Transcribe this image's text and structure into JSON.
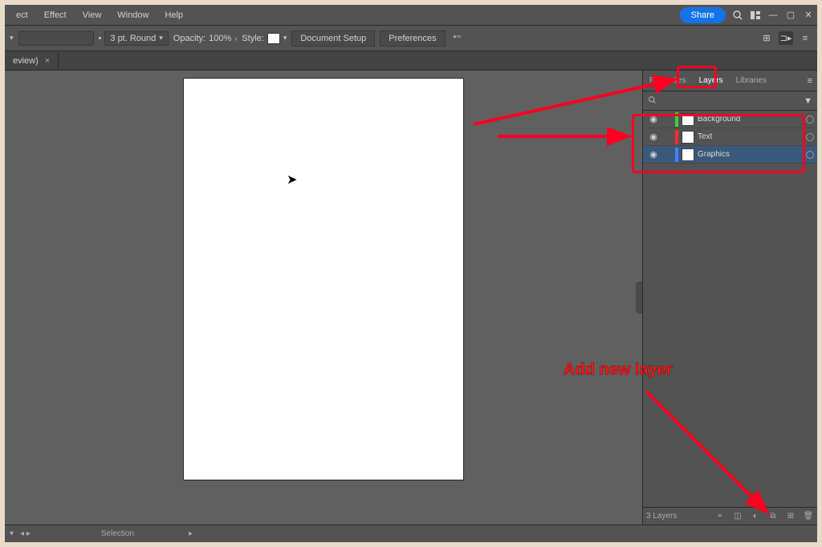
{
  "menu": {
    "items": [
      "ect",
      "Effect",
      "View",
      "Window",
      "Help"
    ],
    "share": "Share"
  },
  "ctrl": {
    "stroke_preset": "3 pt. Round",
    "opacity_label": "Opacity:",
    "opacity_value": "100%",
    "style_label": "Style:",
    "doc_setup": "Document Setup",
    "prefs": "Preferences"
  },
  "tab": {
    "name": "eview)",
    "close": "×"
  },
  "panels": {
    "tabs": [
      "Properties",
      "Layers",
      "Libraries"
    ],
    "active": 1,
    "layers": [
      {
        "name": "Background",
        "color": "#3fce3f"
      },
      {
        "name": "Text",
        "color": "#ff2a2a"
      },
      {
        "name": "Graphics",
        "color": "#4a7cff"
      }
    ],
    "layer_count": "3 Layers"
  },
  "status": {
    "tool": "Selection"
  },
  "annotation": {
    "add_layer": "Add new layer"
  }
}
